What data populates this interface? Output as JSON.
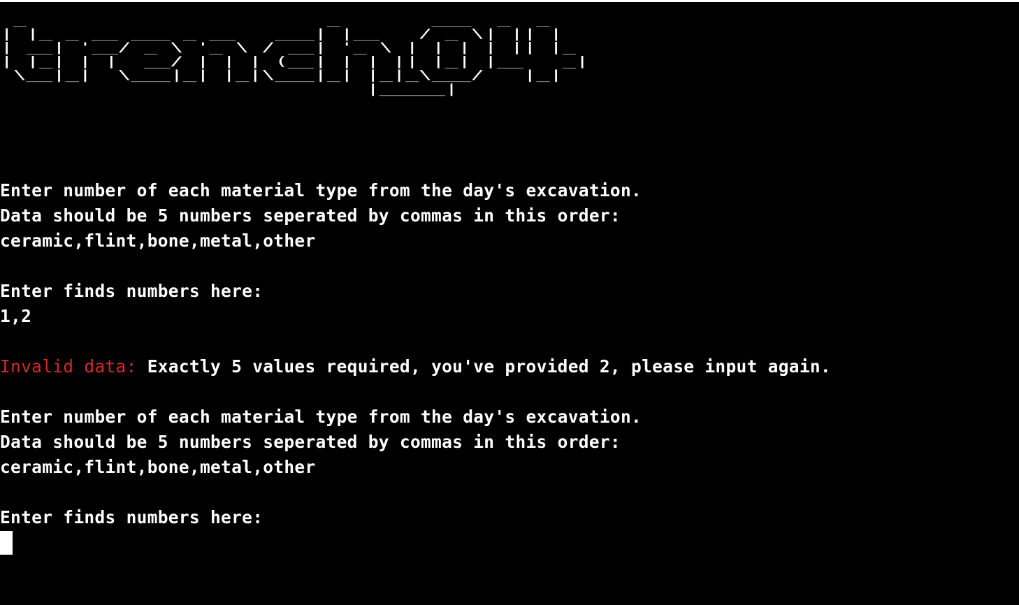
{
  "terminal": {
    "background": "#000000",
    "foreground": "#ffffff",
    "error_color": "#d42a25",
    "banner": " _                       _       ___  _  _   \n| |_ _ __ ___ _ __   ___| |__   / _ \\| || |  \n| __| '__/ _ \\ '_ \\ / __| '_ \\ | | | | || |_ \n| |_| | |  __/ | | | (__| | | || |_| |__   _|\n \\__|_|  \\___|_| |_|\\___|_| |_|_\\___/   |_|  \n                            |_____|          ",
    "block1": {
      "prompt_line1": "Enter number of each material type from the day's excavation.",
      "prompt_line2": "Data should be 5 numbers seperated by commas in this order:",
      "order_line": "ceramic,flint,bone,metal,other",
      "input_prompt": "Enter finds numbers here:",
      "user_input": "1,2"
    },
    "error": {
      "label": "Invalid data:",
      "message": " Exactly 5 values required, you've provided 2, please input again."
    },
    "block2": {
      "prompt_line1": "Enter number of each material type from the day's excavation.",
      "prompt_line2": "Data should be 5 numbers seperated by commas in this order:",
      "order_line": "ceramic,flint,bone,metal,other",
      "input_prompt": "Enter finds numbers here:"
    },
    "cursor_color": "#ffffff"
  }
}
